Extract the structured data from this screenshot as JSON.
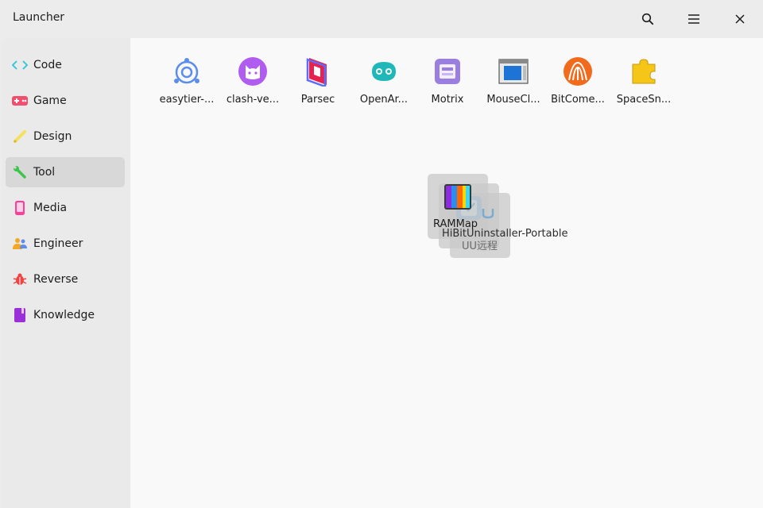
{
  "window": {
    "title": "Launcher"
  },
  "titlebar": {
    "search_icon": "search-icon",
    "menu_icon": "hamburger-menu-icon",
    "close_icon": "close-icon"
  },
  "sidebar": {
    "items": [
      {
        "label": "Code",
        "icon": "code-icon",
        "color": "#2bc4d8"
      },
      {
        "label": "Game",
        "icon": "gamepad-icon",
        "color": "#f0506e"
      },
      {
        "label": "Design",
        "icon": "pen-icon",
        "color": "#f6e05e"
      },
      {
        "label": "Tool",
        "icon": "wrench-icon",
        "color": "#3cc44c",
        "active": true
      },
      {
        "label": "Media",
        "icon": "phone-icon",
        "color": "#ff3d9a"
      },
      {
        "label": "Engineer",
        "icon": "people-icon",
        "color": "#f5a623"
      },
      {
        "label": "Reverse",
        "icon": "bug-icon",
        "color": "#ef4444"
      },
      {
        "label": "Knowledge",
        "icon": "book-icon",
        "color": "#9b30d9"
      }
    ]
  },
  "apps": [
    {
      "label": "easytier-...",
      "icon": "easytier-icon"
    },
    {
      "label": "clash-ve...",
      "icon": "clash-verge-icon"
    },
    {
      "label": "Parsec",
      "icon": "parsec-icon"
    },
    {
      "label": "OpenAr...",
      "icon": "openark-icon"
    },
    {
      "label": "Motrix",
      "icon": "motrix-icon"
    },
    {
      "label": "MouseCl...",
      "icon": "mouse-click-icon"
    },
    {
      "label": "BitCome...",
      "icon": "bitcomet-icon"
    },
    {
      "label": "SpaceSn...",
      "icon": "spacesniffer-icon"
    }
  ],
  "drag_stack": [
    {
      "label": "RAMMap",
      "icon": "rammap-icon"
    },
    {
      "label": "HiBitUninstaller-Portable",
      "icon": "hibit-uninstaller-icon"
    },
    {
      "label": "UU远程",
      "icon": "uu-remote-icon"
    }
  ]
}
